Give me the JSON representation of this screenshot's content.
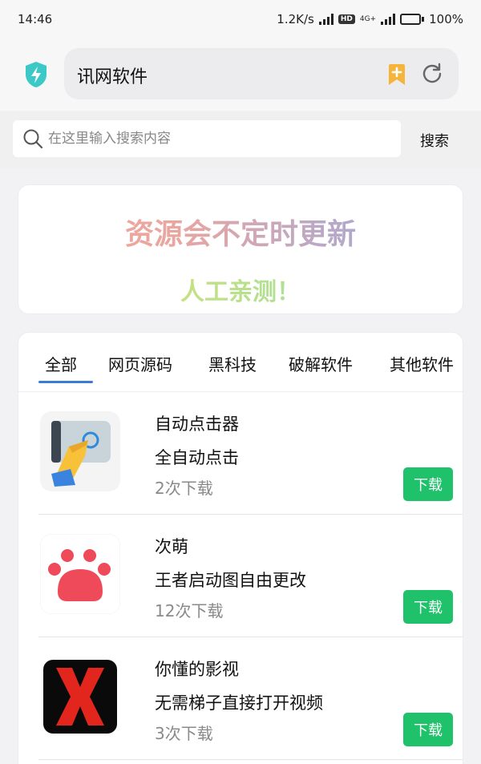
{
  "status_bar": {
    "time": "14:46",
    "net_speed": "1.2K/s",
    "hd": "HD",
    "network_type": "4G+",
    "battery": "100%",
    "battery_level": 1.0
  },
  "header": {
    "title": "讯网软件",
    "shield_icon": "shield-bolt-icon",
    "bookmark_icon": "bookmark-add-icon",
    "refresh_icon": "refresh-icon",
    "accent_shield": "#3dc8c8",
    "accent_bookmark": "#f5b53c"
  },
  "search": {
    "placeholder": "在这里输入搜索内容",
    "button_label": "搜索"
  },
  "banner": {
    "title": "资源会不定时更新",
    "subtitle": "人工亲测！"
  },
  "tabs": [
    {
      "label": "全部",
      "active": true
    },
    {
      "label": "网页源码"
    },
    {
      "label": "黑科技"
    },
    {
      "label": "破解软件"
    },
    {
      "label": "其他软件"
    }
  ],
  "items": [
    {
      "name": "自动点击器",
      "desc": "全自动点击",
      "count": "2次下载",
      "button": "下载",
      "icon": "auto-clicker-icon"
    },
    {
      "name": "次萌",
      "desc": "王者启动图自由更改",
      "count": "12次下载",
      "button": "下载",
      "icon": "paw-icon"
    },
    {
      "name": "你懂的影视",
      "desc": "无需梯子直接打开视频",
      "count": "3次下载",
      "button": "下载",
      "icon": "red-x-icon"
    }
  ],
  "colors": {
    "download_button": "#1fc16a",
    "tab_underline": "#3a7bd5"
  }
}
